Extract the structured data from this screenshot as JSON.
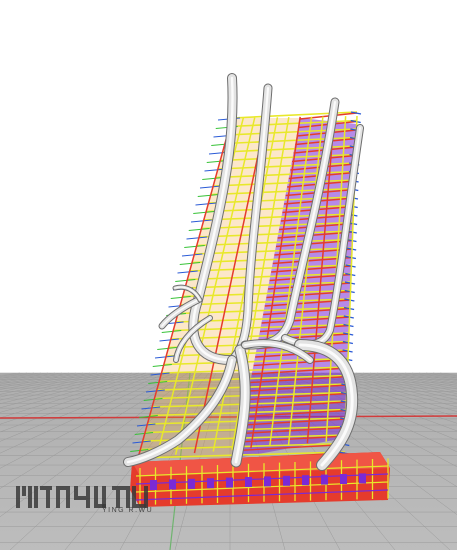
{
  "viewport": {
    "sky_color": "#ffffff",
    "ground_color": "#b4b4b4",
    "grid_line_color": "#9a9a9a",
    "x_axis_color": "#d23c3c",
    "y_axis_color": "#6fb46f"
  },
  "model": {
    "frame_colors": [
      "#e53b2c",
      "#e8e82a",
      "#f2a12a",
      "#7a2ad6",
      "#2a5ad6",
      "#36c236"
    ],
    "branch_color": "#e3e3e3"
  },
  "watermark": {
    "logo_icon": "ying-r-wu-logo-icon",
    "caption": "YING R.WU",
    "logo_color": "#3a3a3a"
  }
}
